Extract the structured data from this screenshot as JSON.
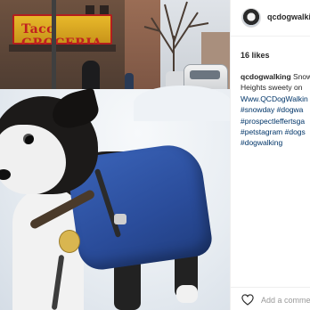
{
  "photo": {
    "store_sign_text": "Taco GROCERIA",
    "alt_subject": "dog-in-blue-coat-in-snow"
  },
  "post": {
    "username": "qcdogwalking",
    "likes": "16 likes",
    "caption_lines": [
      {
        "author": "qcdogwalking",
        "text": " Snow"
      },
      {
        "text": "Heights sweety on"
      },
      {
        "text": "Www.QCDogWalkin"
      },
      {
        "text": "#snowday #dogwa",
        "tag": true
      },
      {
        "text": "#prospectleffertsga",
        "tag": true
      },
      {
        "text": "#petstagram #dogs",
        "tag": true
      },
      {
        "text": "#dogwalking",
        "tag": true
      }
    ]
  },
  "footer": {
    "comment_placeholder": "Add a comment…"
  },
  "icons": {
    "heart": "heart-outline-icon"
  },
  "colors": {
    "hashtag": "#003569",
    "text": "#262626",
    "muted": "#999999",
    "coat": "#2a4c9a"
  }
}
